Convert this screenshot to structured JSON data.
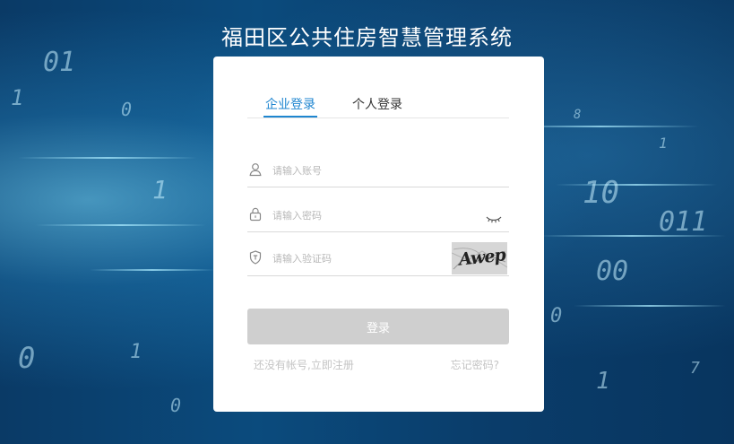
{
  "page": {
    "title": "福田区公共住房智慧管理系统"
  },
  "login_tabs": [
    {
      "label": "企业登录",
      "active": true
    },
    {
      "label": "个人登录",
      "active": false
    }
  ],
  "form": {
    "account_placeholder": "请输入账号",
    "password_placeholder": "请输入密码",
    "captcha_placeholder": "请输入验证码",
    "captcha_text": "Awep",
    "login_label": "登录"
  },
  "links": {
    "register": "还没有帐号,立即注册",
    "forgot": "忘记密码?"
  },
  "colors": {
    "accent": "#1f86d0",
    "button_disabled": "#cfcfcf",
    "background": "#0a3d6b"
  },
  "icons": [
    "user-icon",
    "lock-icon",
    "shield-icon",
    "eye-closed-icon"
  ]
}
